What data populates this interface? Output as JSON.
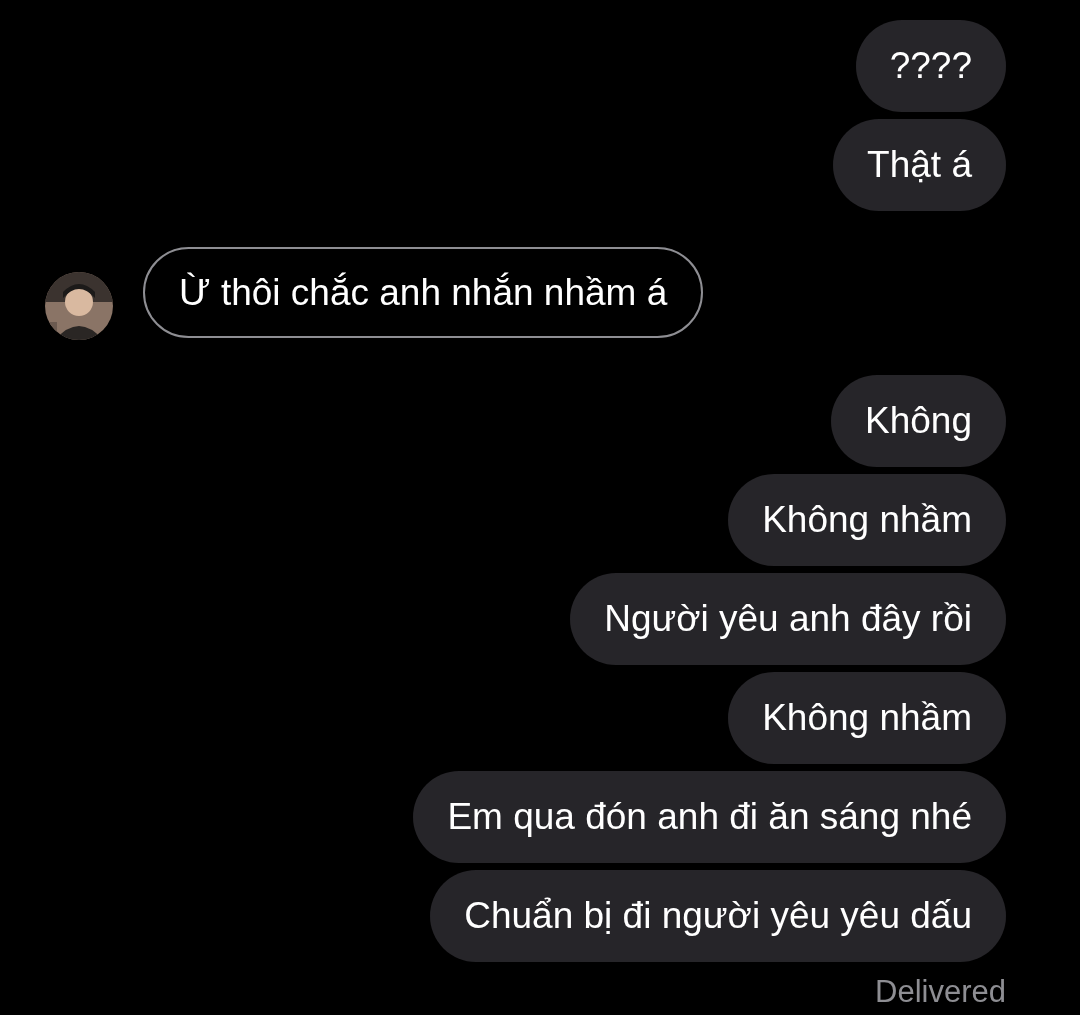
{
  "messages": [
    {
      "kind": "outgoing",
      "text": "????"
    },
    {
      "kind": "outgoing",
      "text": "Thật á"
    },
    {
      "kind": "incoming",
      "text": "Ừ thôi chắc anh nhắn nhầm á"
    },
    {
      "kind": "outgoing",
      "text": "Không"
    },
    {
      "kind": "outgoing",
      "text": "Không nhầm"
    },
    {
      "kind": "outgoing",
      "text": "Người yêu anh đây rồi"
    },
    {
      "kind": "outgoing",
      "text": "Không nhầm"
    },
    {
      "kind": "outgoing",
      "text": "Em qua đón anh đi ăn sáng nhé"
    },
    {
      "kind": "outgoing",
      "text": "Chuẩn bị đi người yêu yêu dấu"
    }
  ],
  "status": "Delivered"
}
